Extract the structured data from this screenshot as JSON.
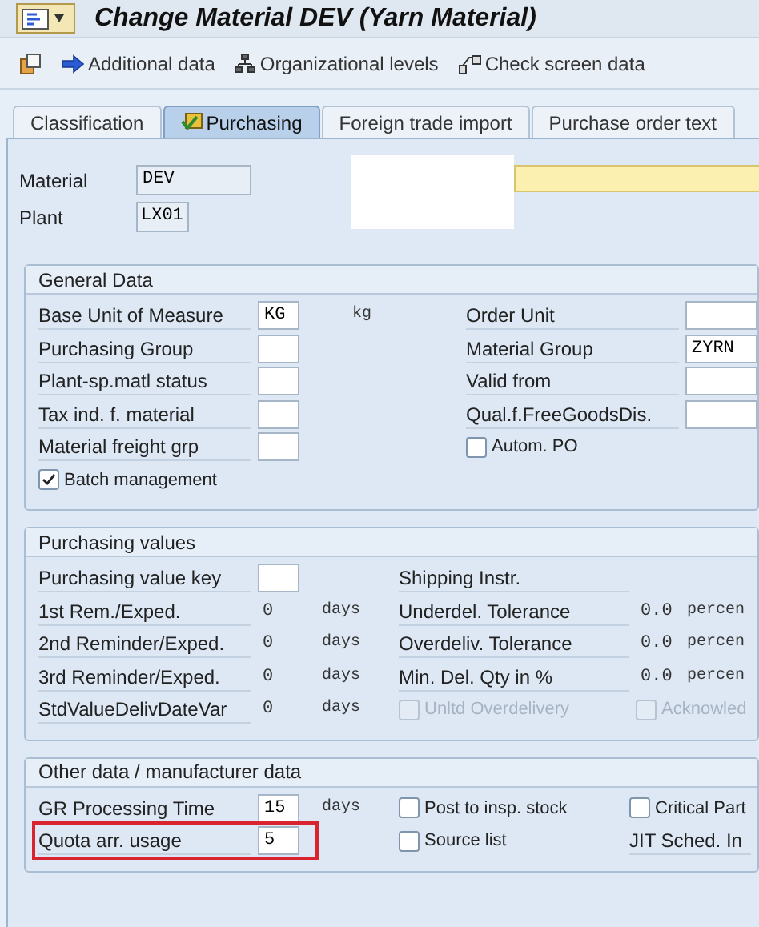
{
  "window": {
    "title": "Change Material DEV (Yarn Material)"
  },
  "toolbar": [
    {
      "kind": "copy"
    },
    {
      "kind": "arrow",
      "label": "Additional data"
    },
    {
      "kind": "org",
      "label": "Organizational levels"
    },
    {
      "kind": "check",
      "label": "Check screen data"
    }
  ],
  "tabs": [
    {
      "label": "Classification",
      "selected": false,
      "icon": false
    },
    {
      "label": "Purchasing",
      "selected": true,
      "icon": true
    },
    {
      "label": "Foreign trade import",
      "selected": false,
      "icon": false
    },
    {
      "label": "Purchase order text",
      "selected": false,
      "icon": false
    }
  ],
  "header": {
    "material_label": "Material",
    "material": "DEV",
    "plant_label": "Plant",
    "plant": "LX01"
  },
  "sections": [
    {
      "title": "General Data",
      "kind": "general",
      "rows": [
        {
          "highlighted": false,
          "cells": [
            {
              "kind": "label",
              "text": "Base Unit of Measure"
            },
            {
              "kind": "input",
              "value": "KG"
            },
            {
              "kind": "unit",
              "text": "kg"
            },
            {
              "kind": "label",
              "text": "Order Unit"
            },
            {
              "kind": "input"
            },
            null
          ]
        },
        {
          "highlighted": false,
          "cells": [
            {
              "kind": "label",
              "text": "Purchasing Group"
            },
            {
              "kind": "input"
            },
            null,
            {
              "kind": "label",
              "text": "Material Group"
            },
            {
              "kind": "input",
              "value": "ZYRN"
            },
            null
          ]
        },
        {
          "highlighted": false,
          "cells": [
            {
              "kind": "label",
              "text": "Plant-sp.matl status"
            },
            {
              "kind": "input"
            },
            null,
            {
              "kind": "label",
              "text": "Valid from"
            },
            {
              "kind": "input"
            },
            null
          ]
        },
        {
          "highlighted": false,
          "cells": [
            {
              "kind": "label",
              "text": "Tax ind. f. material"
            },
            {
              "kind": "input"
            },
            null,
            {
              "kind": "label",
              "text": "Qual.f.FreeGoodsDis."
            },
            {
              "kind": "input"
            },
            null
          ]
        },
        {
          "highlighted": false,
          "cells": [
            {
              "kind": "label",
              "text": "Material freight grp"
            },
            {
              "kind": "input"
            },
            null,
            {
              "kind": "check",
              "label": "Autom. PO",
              "checked": false,
              "disabled": false
            },
            null,
            null
          ]
        },
        {
          "highlighted": false,
          "cells": [
            {
              "kind": "check",
              "label": "Batch management",
              "checked": true,
              "disabled": false
            }
          ]
        }
      ]
    },
    {
      "title": "Purchasing values",
      "kind": "values",
      "rows": [
        {
          "highlighted": false,
          "cells": [
            {
              "kind": "label",
              "text": "Purchasing value key"
            },
            {
              "kind": "input"
            },
            null,
            {
              "kind": "label",
              "text": "Shipping Instr."
            },
            null,
            null
          ]
        },
        {
          "highlighted": false,
          "cells": [
            {
              "kind": "label",
              "text": "1st Rem./Exped."
            },
            {
              "kind": "display",
              "value": "0"
            },
            {
              "kind": "unit",
              "text": "days"
            },
            {
              "kind": "label",
              "text": "Underdel. Tolerance"
            },
            {
              "kind": "display",
              "value": "0.0"
            },
            {
              "kind": "unit",
              "text": "percen"
            }
          ]
        },
        {
          "highlighted": false,
          "cells": [
            {
              "kind": "label",
              "text": "2nd Reminder/Exped."
            },
            {
              "kind": "display",
              "value": "0"
            },
            {
              "kind": "unit",
              "text": "days"
            },
            {
              "kind": "label",
              "text": "Overdeliv. Tolerance"
            },
            {
              "kind": "display",
              "value": "0.0"
            },
            {
              "kind": "unit",
              "text": "percen"
            }
          ]
        },
        {
          "highlighted": false,
          "cells": [
            {
              "kind": "label",
              "text": "3rd Reminder/Exped."
            },
            {
              "kind": "display",
              "value": "0"
            },
            {
              "kind": "unit",
              "text": "days"
            },
            {
              "kind": "label",
              "text": "Min. Del. Qty in %"
            },
            {
              "kind": "display",
              "value": "0.0"
            },
            {
              "kind": "unit",
              "text": "percen"
            }
          ]
        },
        {
          "highlighted": false,
          "cells": [
            {
              "kind": "label",
              "text": "StdValueDelivDateVar"
            },
            {
              "kind": "display",
              "value": "0"
            },
            {
              "kind": "unit",
              "text": "days"
            },
            {
              "kind": "check",
              "label": "Unltd Overdelivery",
              "checked": false,
              "disabled": true
            },
            {
              "kind": "check",
              "label": "Acknowled",
              "checked": false,
              "disabled": true
            }
          ]
        }
      ]
    },
    {
      "title": "Other data / manufacturer data",
      "kind": "other",
      "rows": [
        {
          "highlighted": false,
          "cells": [
            {
              "kind": "label",
              "text": "GR Processing Time"
            },
            {
              "kind": "input",
              "value": "15"
            },
            {
              "kind": "unit",
              "text": "days"
            },
            {
              "kind": "check",
              "label": "Post to insp. stock",
              "checked": false,
              "disabled": false
            },
            {
              "kind": "check",
              "label": "Critical Part",
              "checked": false,
              "disabled": false
            }
          ]
        },
        {
          "highlighted": true,
          "cells": [
            {
              "kind": "label",
              "text": "Quota arr. usage"
            },
            {
              "kind": "input",
              "value": "5"
            },
            null,
            {
              "kind": "check",
              "label": "Source list",
              "checked": false,
              "disabled": false
            },
            {
              "kind": "label",
              "text": "JIT Sched. In"
            }
          ]
        }
      ]
    }
  ]
}
